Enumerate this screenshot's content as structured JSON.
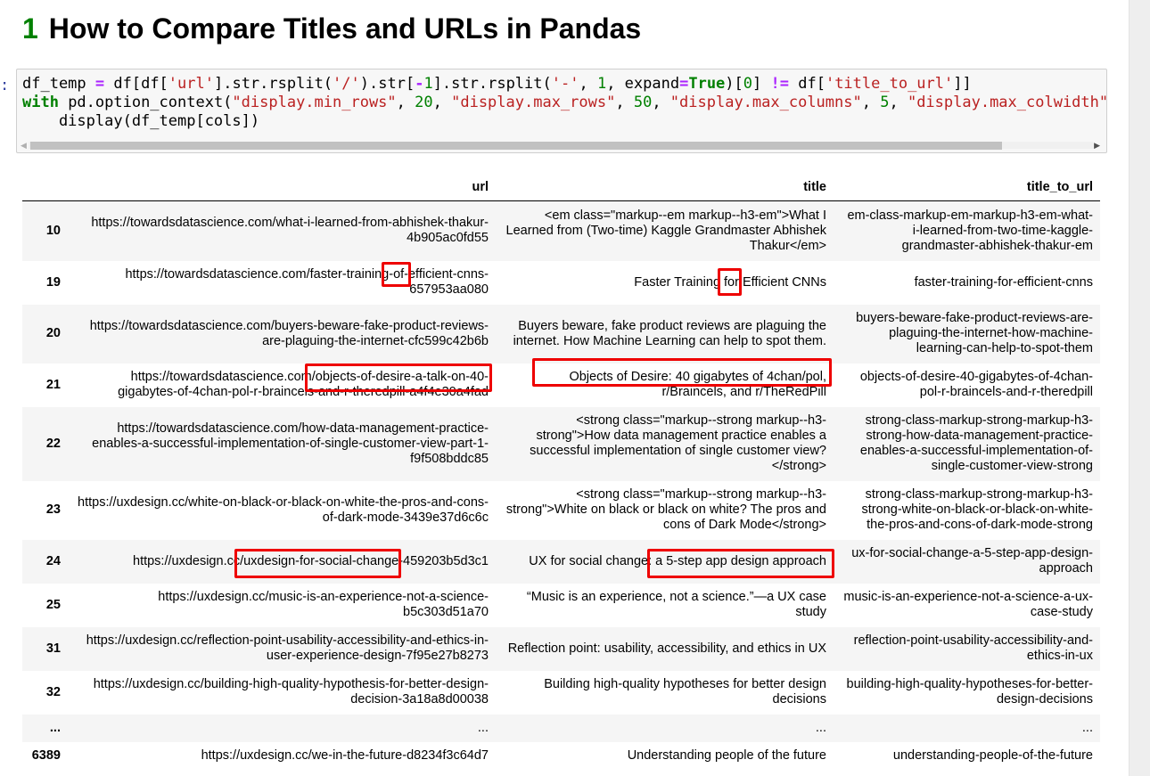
{
  "heading": {
    "number": "1",
    "text": "How to Compare Titles and URLs in Pandas"
  },
  "cell": {
    "prompt": ":",
    "code_lines": [
      [
        [
          "df_temp ",
          ""
        ],
        [
          "=",
          "op"
        ],
        [
          " df[df[",
          ""
        ],
        [
          "'url'",
          "str"
        ],
        [
          "].str.rsplit(",
          ""
        ],
        [
          "'/'",
          "str"
        ],
        [
          ").str[",
          ""
        ],
        [
          "-",
          "op"
        ],
        [
          "1",
          "num"
        ],
        [
          "].str.rsplit(",
          ""
        ],
        [
          "'-'",
          "str"
        ],
        [
          ", ",
          ""
        ],
        [
          "1",
          "num"
        ],
        [
          ", expand",
          ""
        ],
        [
          "=",
          "op"
        ],
        [
          "True",
          "kw"
        ],
        [
          ")[",
          ""
        ],
        [
          "0",
          "num"
        ],
        [
          "] ",
          ""
        ],
        [
          "!=",
          "op"
        ],
        [
          " df[",
          ""
        ],
        [
          "'title_to_url'",
          "str"
        ],
        [
          "]]",
          ""
        ]
      ],
      [
        [
          "with",
          "kw"
        ],
        [
          " pd.option_context(",
          ""
        ],
        [
          "\"display.min_rows\"",
          "str"
        ],
        [
          ", ",
          ""
        ],
        [
          "20",
          "num"
        ],
        [
          ", ",
          ""
        ],
        [
          "\"display.max_rows\"",
          "str"
        ],
        [
          ", ",
          ""
        ],
        [
          "50",
          "num"
        ],
        [
          ", ",
          ""
        ],
        [
          "\"display.max_columns\"",
          "str"
        ],
        [
          ", ",
          ""
        ],
        [
          "5",
          "num"
        ],
        [
          ", ",
          ""
        ],
        [
          "\"display.max_colwidth\"",
          "str"
        ]
      ],
      [
        [
          "    display(df_temp[cols])",
          ""
        ]
      ]
    ]
  },
  "table": {
    "columns": [
      "",
      "url",
      "title",
      "title_to_url"
    ],
    "rows": [
      {
        "index": "10",
        "url": "https://towardsdatascience.com/what-i-learned-from-abhishek-thakur-4b905ac0fd55",
        "title": "<em class=\"markup--em markup--h3-em\">What I Learned from (Two-time) Kaggle Grandmaster Abhishek Thakur</em>",
        "title_to_url": "em-class-markup-em-markup-h3-em-what-i-learned-from-two-time-kaggle-grandmaster-abhishek-thakur-em"
      },
      {
        "index": "19",
        "url": "https://towardsdatascience.com/faster-training-of-efficient-cnns-657953aa080",
        "title": "Faster Training for Efficient CNNs",
        "title_to_url": "faster-training-for-efficient-cnns"
      },
      {
        "index": "20",
        "url": "https://towardsdatascience.com/buyers-beware-fake-product-reviews-are-plaguing-the-internet-cfc599c42b6b",
        "title": "Buyers beware, fake product reviews are plaguing the internet. How Machine Learning can help to spot them.",
        "title_to_url": "buyers-beware-fake-product-reviews-are-plaguing-the-internet-how-machine-learning-can-help-to-spot-them"
      },
      {
        "index": "21",
        "url": "https://towardsdatascience.com/objects-of-desire-a-talk-on-40-gigabytes-of-4chan-pol-r-braincels-and-r-theredpill-a4f4e30a4fad",
        "title": "Objects of Desire: 40 gigabytes of 4chan/pol, r/Braincels, and r/TheRedPill",
        "title_to_url": "objects-of-desire-40-gigabytes-of-4chan-pol-r-braincels-and-r-theredpill"
      },
      {
        "index": "22",
        "url": "https://towardsdatascience.com/how-data-management-practice-enables-a-successful-implementation-of-single-customer-view-part-1-f9f508bddc85",
        "title": "<strong class=\"markup--strong markup--h3-strong\">How data management practice enables a successful implementation of single customer view?</strong>",
        "title_to_url": "strong-class-markup-strong-markup-h3-strong-how-data-management-practice-enables-a-successful-implementation-of-single-customer-view-strong"
      },
      {
        "index": "23",
        "url": "https://uxdesign.cc/white-on-black-or-black-on-white-the-pros-and-cons-of-dark-mode-3439e37d6c6c",
        "title": "<strong class=\"markup--strong markup--h3-strong\">White on black or black on white? The pros and cons of Dark Mode</strong>",
        "title_to_url": "strong-class-markup-strong-markup-h3-strong-white-on-black-or-black-on-white-the-pros-and-cons-of-dark-mode-strong"
      },
      {
        "index": "24",
        "url": "https://uxdesign.cc/uxdesign-for-social-change-459203b5d3c1",
        "title": "UX for social change: a 5-step app design approach",
        "title_to_url": "ux-for-social-change-a-5-step-app-design-approach"
      },
      {
        "index": "25",
        "url": "https://uxdesign.cc/music-is-an-experience-not-a-science-b5c303d51a70",
        "title": "“Music is an experience, not a science.”—a UX case study",
        "title_to_url": "music-is-an-experience-not-a-science-a-ux-case-study"
      },
      {
        "index": "31",
        "url": "https://uxdesign.cc/reflection-point-usability-accessibility-and-ethics-in-user-experience-design-7f95e27b8273",
        "title": "Reflection point: usability, accessibility, and ethics in UX",
        "title_to_url": "reflection-point-usability-accessibility-and-ethics-in-ux"
      },
      {
        "index": "32",
        "url": "https://uxdesign.cc/building-high-quality-hypothesis-for-better-design-decision-3a18a8d00038",
        "title": "Building high-quality hypotheses for better design decisions",
        "title_to_url": "building-high-quality-hypotheses-for-better-design-decisions"
      },
      {
        "index": "...",
        "url": "...",
        "title": "...",
        "title_to_url": "..."
      },
      {
        "index": "6389",
        "url": "https://uxdesign.cc/we-in-the-future-d8234f3c64d7",
        "title": "Understanding people of the future",
        "title_to_url": "understanding-people-of-the-future"
      }
    ]
  },
  "annotations": {
    "highlight_color": "#ee0000"
  }
}
